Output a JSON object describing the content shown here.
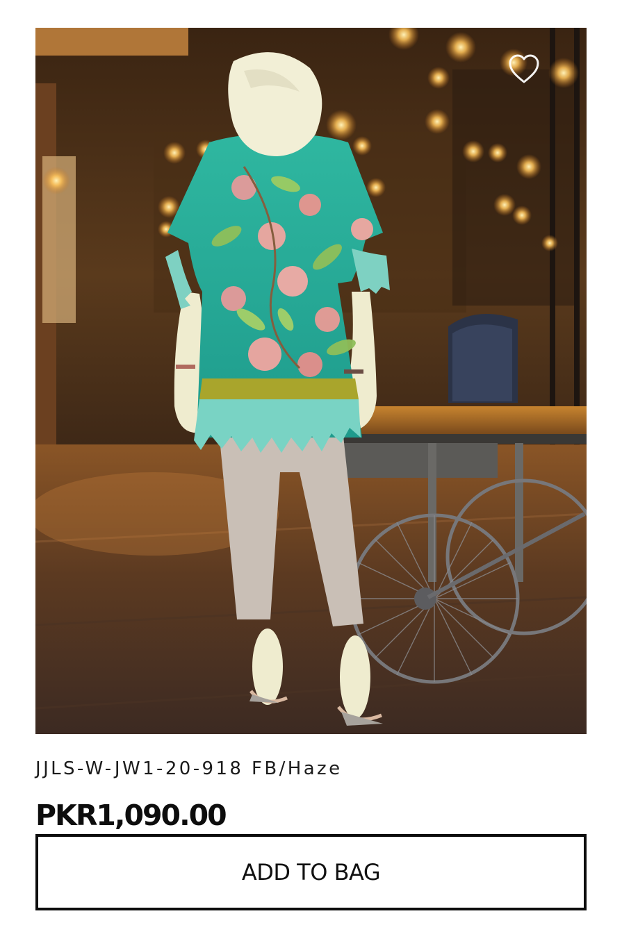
{
  "product": {
    "name": "JJLS-W-JW1-20-918 FB/Haze",
    "price": "PKR1,090.00",
    "add_to_bag_label": "ADD TO BAG",
    "wishlist_icon": "heart-outline-icon",
    "image_subject": "mannequin-in-floral-kurta-photo"
  },
  "colors": {
    "text": "#111111",
    "button_border": "#0d0d0d",
    "background": "#ffffff"
  }
}
